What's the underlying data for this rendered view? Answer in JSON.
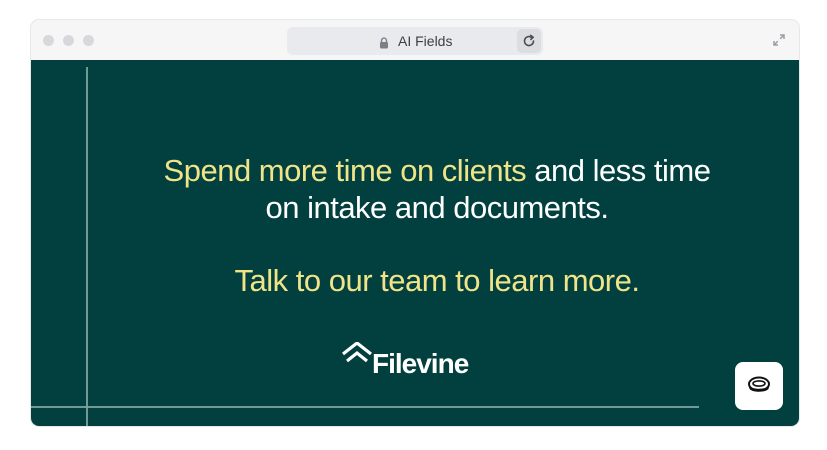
{
  "browser": {
    "url_title": "AI Fields",
    "icons": {
      "lock": "lock-icon",
      "reload": "reload-icon",
      "expand": "expand-icon"
    }
  },
  "hero": {
    "headline_highlight": "Spend more time on clients",
    "headline_rest_line1": " and less time",
    "headline_line2": "on intake and documents.",
    "cta": "Talk to our team to learn more."
  },
  "brand": {
    "name": "Filevine"
  },
  "colors": {
    "background": "#024040",
    "highlight": "#f0e488",
    "text": "#ffffff"
  },
  "widget": {
    "icon": "chat-bubble-icon"
  }
}
